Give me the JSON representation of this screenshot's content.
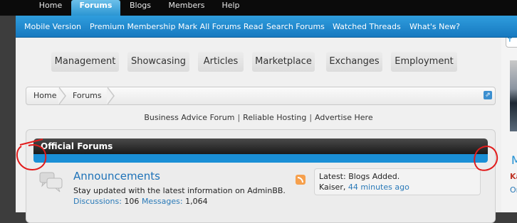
{
  "top_nav": {
    "tabs": [
      {
        "label": "Home",
        "active": false
      },
      {
        "label": "Forums",
        "active": true
      },
      {
        "label": "Blogs",
        "active": false
      },
      {
        "label": "Members",
        "active": false
      },
      {
        "label": "Help",
        "active": false
      }
    ]
  },
  "sub_nav": {
    "links": [
      "Mobile Version",
      "Premium Membership",
      "Mark All Forums Read",
      "Search Forums",
      "Watched Threads",
      "What's New?"
    ]
  },
  "categories": [
    "Management",
    "Showcasing",
    "Articles",
    "Marketplace",
    "Exchanges",
    "Employment"
  ],
  "breadcrumb": [
    "Home",
    "Forums"
  ],
  "ad_links": [
    "Business Advice Forum",
    "Reliable Hosting",
    "Advertise Here"
  ],
  "ad_separator": "|",
  "section": {
    "title": "Official Forums",
    "forums": [
      {
        "name": "Announcements",
        "description": "Stay updated with the latest information on AdminBB.",
        "discussions_label": "Discussions:",
        "discussions": "106",
        "messages_label": "Messages:",
        "messages": "1,064",
        "latest_label": "Latest:",
        "latest_title": "Blogs Added.",
        "latest_user": "Kaiser,",
        "latest_time": "44 minutes ago"
      }
    ]
  },
  "sidebar": {
    "heading_fragment": "M",
    "text_red_fragment": "Ka",
    "text_link_fragment": "Or"
  },
  "colors": {
    "accent_blue": "#1a8fd6",
    "annotation_red": "#e21b1b"
  }
}
